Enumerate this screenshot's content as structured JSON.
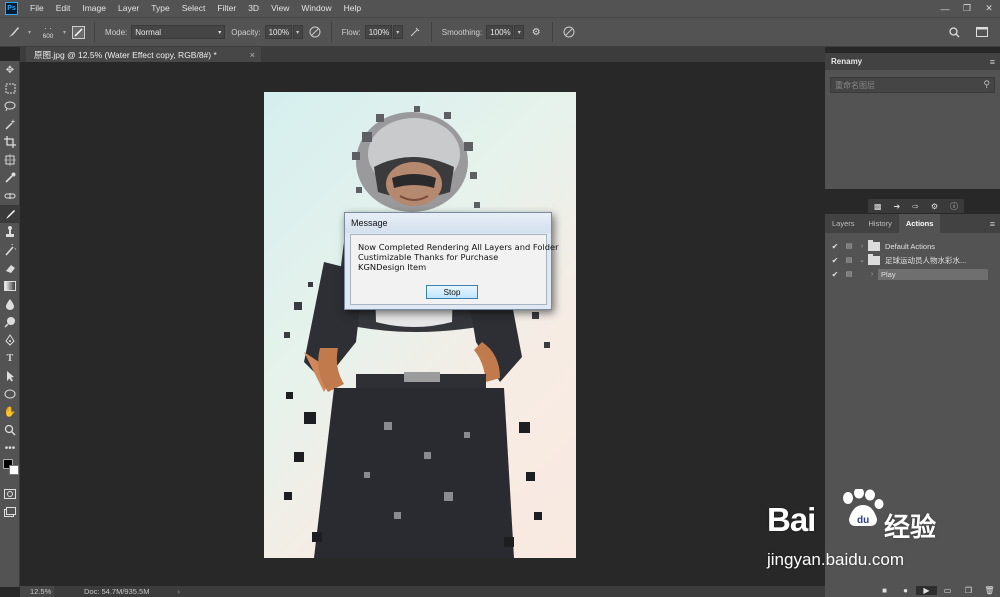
{
  "app": {
    "logo": "Ps"
  },
  "menu": [
    "File",
    "Edit",
    "Image",
    "Layer",
    "Type",
    "Select",
    "Filter",
    "3D",
    "View",
    "Window",
    "Help"
  ],
  "options": {
    "brush_size": "600",
    "mode_label": "Mode:",
    "mode_value": "Normal",
    "opacity_label": "Opacity:",
    "opacity_value": "100%",
    "flow_label": "Flow:",
    "flow_value": "100%",
    "smoothing_label": "Smoothing:",
    "smoothing_value": "100%"
  },
  "document": {
    "tab_title": "原图.jpg @ 12.5% (Water Effect copy, RGB/8#) *",
    "close": "×"
  },
  "dialog": {
    "title": "Message",
    "line1": "Now Completed Rendering All Layers and Folder",
    "line2": "Custimizable Thanks for Purchase",
    "line3": "KGNDesign Item",
    "button": "Stop"
  },
  "status": {
    "zoom": "12.5%",
    "doc_size": "Doc: 54.7M/935.5M",
    "arrow": "›"
  },
  "renamy": {
    "title": "Renamy",
    "search_placeholder": "重命名图层"
  },
  "panel_tabs": [
    "Layers",
    "History",
    "Actions"
  ],
  "actions": [
    {
      "label": "Default Actions",
      "toggle": "›"
    },
    {
      "label": "足球运动员人物水彩水...",
      "toggle": "⌄"
    },
    {
      "label": "Play",
      "toggle": "›"
    }
  ],
  "watermark": {
    "brand": "Bai",
    "suffix": "经验",
    "url": "jingyan.baidu.com"
  },
  "colors": {
    "foreground": "#000000",
    "background": "#ffffff",
    "accent": "#31a8ff"
  }
}
